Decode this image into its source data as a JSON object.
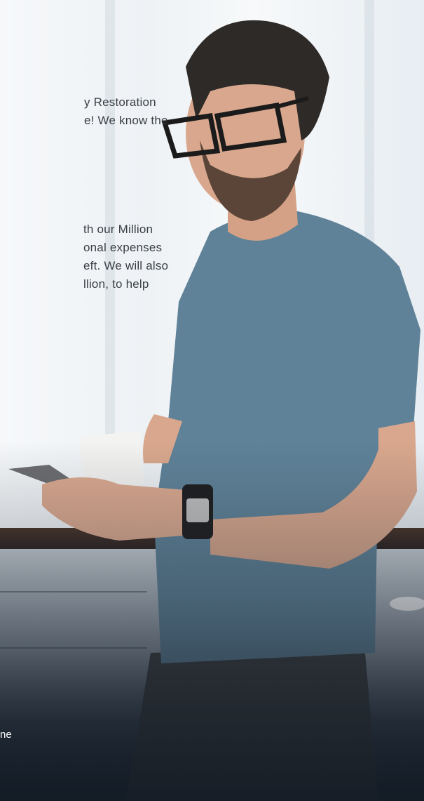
{
  "paragraph_intro": {
    "line1": "y Restoration",
    "line2": "e! We know the"
  },
  "paragraph_main": {
    "line1": "th our Million",
    "line2": "onal expenses",
    "line3": "eft. We will also",
    "line4": "llion, to help"
  },
  "footer_fragment": "ne",
  "colors": {
    "text_dark": "#3a3f45",
    "shirt": "#5f8298",
    "footer_text": "#ffffff"
  }
}
